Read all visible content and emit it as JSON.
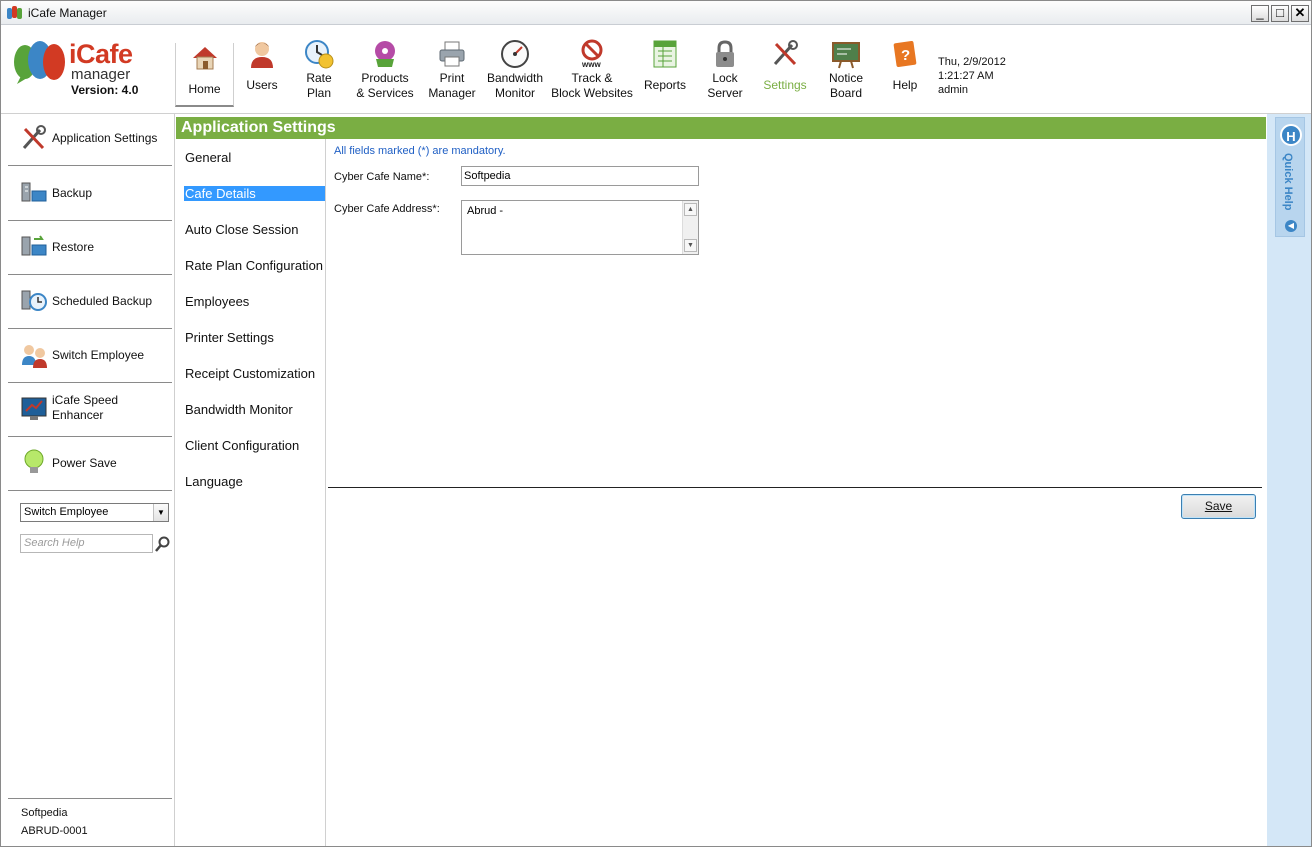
{
  "window": {
    "title": "iCafe Manager",
    "min": "_",
    "max": "□",
    "close": "✕"
  },
  "logo": {
    "brand": "iCafe",
    "sub": "manager",
    "version": "Version: 4.0"
  },
  "toolbar": [
    {
      "label": "Home",
      "icon": "home-icon"
    },
    {
      "label": "Users",
      "icon": "user-icon"
    },
    {
      "label": "Rate Plan",
      "icon": "rate-plan-icon"
    },
    {
      "label": "Products & Services",
      "icon": "products-icon"
    },
    {
      "label": "Print Manager",
      "icon": "printer-icon"
    },
    {
      "label": "Bandwidth Monitor",
      "icon": "gauge-icon"
    },
    {
      "label": "Track & Block Websites",
      "icon": "block-web-icon"
    },
    {
      "label": "Reports",
      "icon": "reports-icon"
    },
    {
      "label": "Lock Server",
      "icon": "lock-icon"
    },
    {
      "label": "Settings",
      "icon": "settings-icon"
    },
    {
      "label": "Notice Board",
      "icon": "notice-board-icon"
    },
    {
      "label": "Help",
      "icon": "help-icon"
    }
  ],
  "datetime": {
    "date": "Thu, 2/9/2012",
    "time": "1:21:27 AM",
    "user": "admin"
  },
  "leftnav": {
    "items": [
      {
        "label": "Application Settings",
        "icon": "tools-icon"
      },
      {
        "label": "Backup",
        "icon": "backup-icon"
      },
      {
        "label": "Restore",
        "icon": "restore-icon"
      },
      {
        "label": "Scheduled Backup",
        "icon": "scheduled-backup-icon"
      },
      {
        "label": "Switch Employee",
        "icon": "switch-employee-icon"
      },
      {
        "label": "iCafe Speed Enhancer",
        "icon": "speed-enhancer-icon"
      },
      {
        "label": "Power Save",
        "icon": "bulb-icon"
      }
    ],
    "combo_value": "Switch Employee",
    "search_placeholder": "Search Help",
    "footer_user": "Softpedia",
    "footer_code": "ABRUD-0001"
  },
  "main": {
    "header": "Application Settings",
    "subnav": [
      "General",
      "Cafe Details",
      "Auto Close Session",
      "Rate Plan Configuration",
      "Employees",
      "Printer Settings",
      "Receipt Customization",
      "Bandwidth Monitor",
      "Client Configuration",
      "Language"
    ],
    "selected_subnav": "Cafe Details",
    "mandatory_note": "All fields marked (*) are mandatory.",
    "name_label": "Cyber Cafe Name*:",
    "name_value": "Softpedia",
    "address_label": "Cyber Cafe Address*:",
    "address_value": "Abrud -",
    "save_label": "Save"
  },
  "quickhelp": {
    "badge": "H",
    "label": "Quick Help"
  },
  "colors": {
    "accent_green": "#7aae43",
    "selection_blue": "#3399ff",
    "quickhelp_blue": "#d4e7f7"
  }
}
